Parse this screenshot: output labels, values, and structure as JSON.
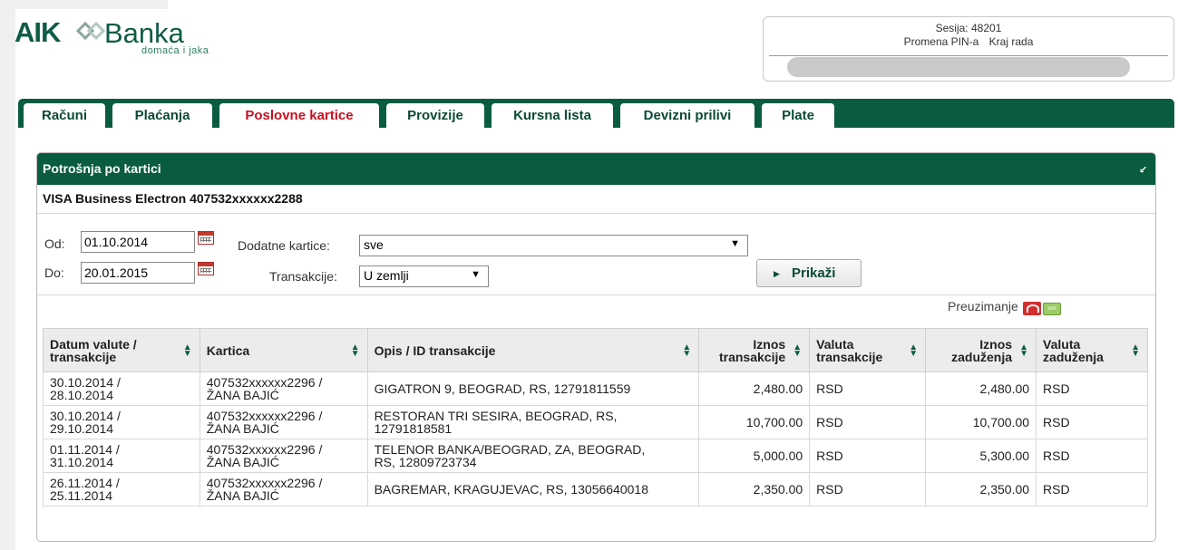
{
  "brand": {
    "name_left": "AIK",
    "name_right": "Banka",
    "tagline": "domaća i jaka"
  },
  "session": {
    "label": "Sesija:",
    "id": "48201",
    "change_pin": "Promena PIN-a",
    "logout": "Kraj rada"
  },
  "tabs": [
    {
      "label": "Računi",
      "active": false
    },
    {
      "label": "Plaćanja",
      "active": false
    },
    {
      "label": "Poslovne kartice",
      "active": true
    },
    {
      "label": "Provizije",
      "active": false
    },
    {
      "label": "Kursna lista",
      "active": false
    },
    {
      "label": "Devizni prilivi",
      "active": false
    },
    {
      "label": "Plate",
      "active": false
    }
  ],
  "panel": {
    "title": "Potrošnja po kartici",
    "card": "VISA Business Electron 407532xxxxxx2288"
  },
  "filters": {
    "from_label": "Od:",
    "from_value": "01.10.2014",
    "to_label": "Do:",
    "to_value": "20.01.2015",
    "extra_cards_label": "Dodatne kartice:",
    "extra_cards_value": "sve",
    "transactions_label": "Transakcije:",
    "transactions_value": "U zemlji",
    "show_button": "Prikaži"
  },
  "download": {
    "label": "Preuzimanje",
    "icons": [
      "pdf-icon",
      "xml-icon"
    ]
  },
  "table": {
    "headers": [
      "Datum valute / transakcije",
      "Kartica",
      "Opis / ID transakcije",
      "Iznos transakcije",
      "Valuta transakcije",
      "Iznos zaduženja",
      "Valuta zaduženja"
    ],
    "header_lines": [
      [
        "Datum valute /",
        "transakcije"
      ],
      [
        "Kartica"
      ],
      [
        "Opis / ID transakcije"
      ],
      [
        "Iznos",
        "transakcije"
      ],
      [
        "Valuta",
        "transakcije"
      ],
      [
        "Iznos",
        "zaduženja"
      ],
      [
        "Valuta",
        "zaduženja"
      ]
    ],
    "rows": [
      {
        "date": [
          "30.10.2014 /",
          "28.10.2014"
        ],
        "card": [
          "407532xxxxxx2296 /",
          "ŽANA BAJIĆ"
        ],
        "desc": [
          "GIGATRON 9, BEOGRAD, RS, 12791811559"
        ],
        "amount": "2,480.00",
        "currency": "RSD",
        "charged": "2,480.00",
        "charged_currency": "RSD"
      },
      {
        "date": [
          "30.10.2014 /",
          "29.10.2014"
        ],
        "card": [
          "407532xxxxxx2296 /",
          "ŽANA BAJIĆ"
        ],
        "desc": [
          "RESTORAN TRI SESIRA, BEOGRAD, RS,",
          "12791818581"
        ],
        "amount": "10,700.00",
        "currency": "RSD",
        "charged": "10,700.00",
        "charged_currency": "RSD"
      },
      {
        "date": [
          "01.11.2014 /",
          "31.10.2014"
        ],
        "card": [
          "407532xxxxxx2296 /",
          "ŽANA BAJIĆ"
        ],
        "desc": [
          "TELENOR BANKA/BEOGRAD, ZA, BEOGRAD,",
          "RS, 12809723734"
        ],
        "amount": "5,000.00",
        "currency": "RSD",
        "charged": "5,300.00",
        "charged_currency": "RSD"
      },
      {
        "date": [
          "26.11.2014 /",
          "25.11.2014"
        ],
        "card": [
          "407532xxxxxx2296 /",
          "ŽANA BAJIĆ"
        ],
        "desc": [
          "BAGREMAR, KRAGUJEVAC, RS, 13056640018"
        ],
        "amount": "2,350.00",
        "currency": "RSD",
        "charged": "2,350.00",
        "charged_currency": "RSD"
      }
    ]
  },
  "colors": {
    "brand_green": "#0a5c3f",
    "active_tab": "#c8101f"
  }
}
